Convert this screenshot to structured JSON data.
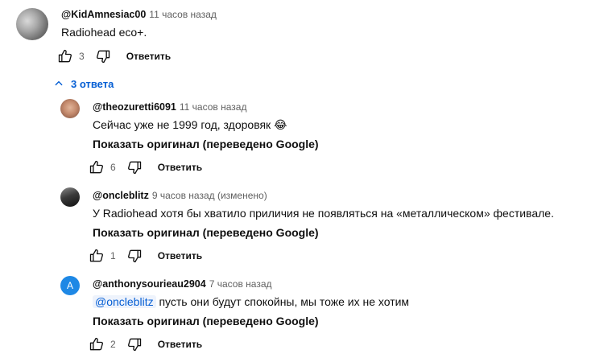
{
  "top_comment": {
    "author": "@KidAmnesiac00",
    "time": "11 часов назад",
    "text": "Radiohead eco+.",
    "likes": "3",
    "reply_label": "Ответить"
  },
  "replies_toggle": {
    "label": "3 ответа",
    "icon": "chevron-up-icon"
  },
  "replies": [
    {
      "author": "@theozuretti6091",
      "time": "11 часов назад",
      "text": "Сейчас уже не 1999 год, здоровяк 😂",
      "show_original": "Показать оригинал (переведено Google)",
      "likes": "6",
      "reply_label": "Ответить"
    },
    {
      "author": "@oncleblitz",
      "time": "9 часов назад (изменено)",
      "text": "У Radiohead хотя бы хватило приличия не появляться на «металлическом» фестивале.",
      "show_original": "Показать оригинал (переведено Google)",
      "likes": "1",
      "reply_label": "Ответить"
    },
    {
      "author": "@anthonysourieau2904",
      "avatar_letter": "A",
      "avatar_color": "#1e88e5",
      "time": "7 часов назад",
      "mention": "@oncleblitz",
      "text": "пусть они будут спокойны, мы тоже их не хотим",
      "show_original": "Показать оригинал (переведено Google)",
      "likes": "2",
      "reply_label": "Ответить"
    }
  ],
  "colors": {
    "link": "#065fd4",
    "secondary_text": "#606060"
  }
}
